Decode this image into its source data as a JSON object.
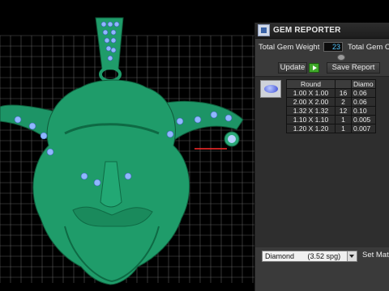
{
  "viewport": {
    "colors": {
      "background": "#000000",
      "grid": "#5a5a5a",
      "model": "#1f9c6a",
      "gems": "#8fb7ff",
      "guide_line": "#ff2a2a"
    }
  },
  "panel": {
    "title": "GEM REPORTER",
    "total_gem_weight_label": "Total Gem Weight",
    "total_gem_weight_value": "23",
    "total_gem_count_label": "Total Gem C",
    "update_label": "Update",
    "save_report_label": "Save Report",
    "table": {
      "headers": [
        "Round",
        "",
        "Diamo"
      ],
      "rows": [
        {
          "size": "1.00 X 1.00",
          "qty": "16",
          "weight": "0.06"
        },
        {
          "size": "2.00 X 2.00",
          "qty": "2",
          "weight": "0.06"
        },
        {
          "size": "1.32 X 1.32",
          "qty": "12",
          "weight": "0.10"
        },
        {
          "size": "1.10 X 1.10",
          "qty": "1",
          "weight": "0.005"
        },
        {
          "size": "1.20 X 1.20",
          "qty": "1",
          "weight": "0.007"
        }
      ]
    },
    "material_select": {
      "value": "Diamond",
      "density": "(3.52 spg)"
    },
    "set_material_label": "Set Mat"
  }
}
